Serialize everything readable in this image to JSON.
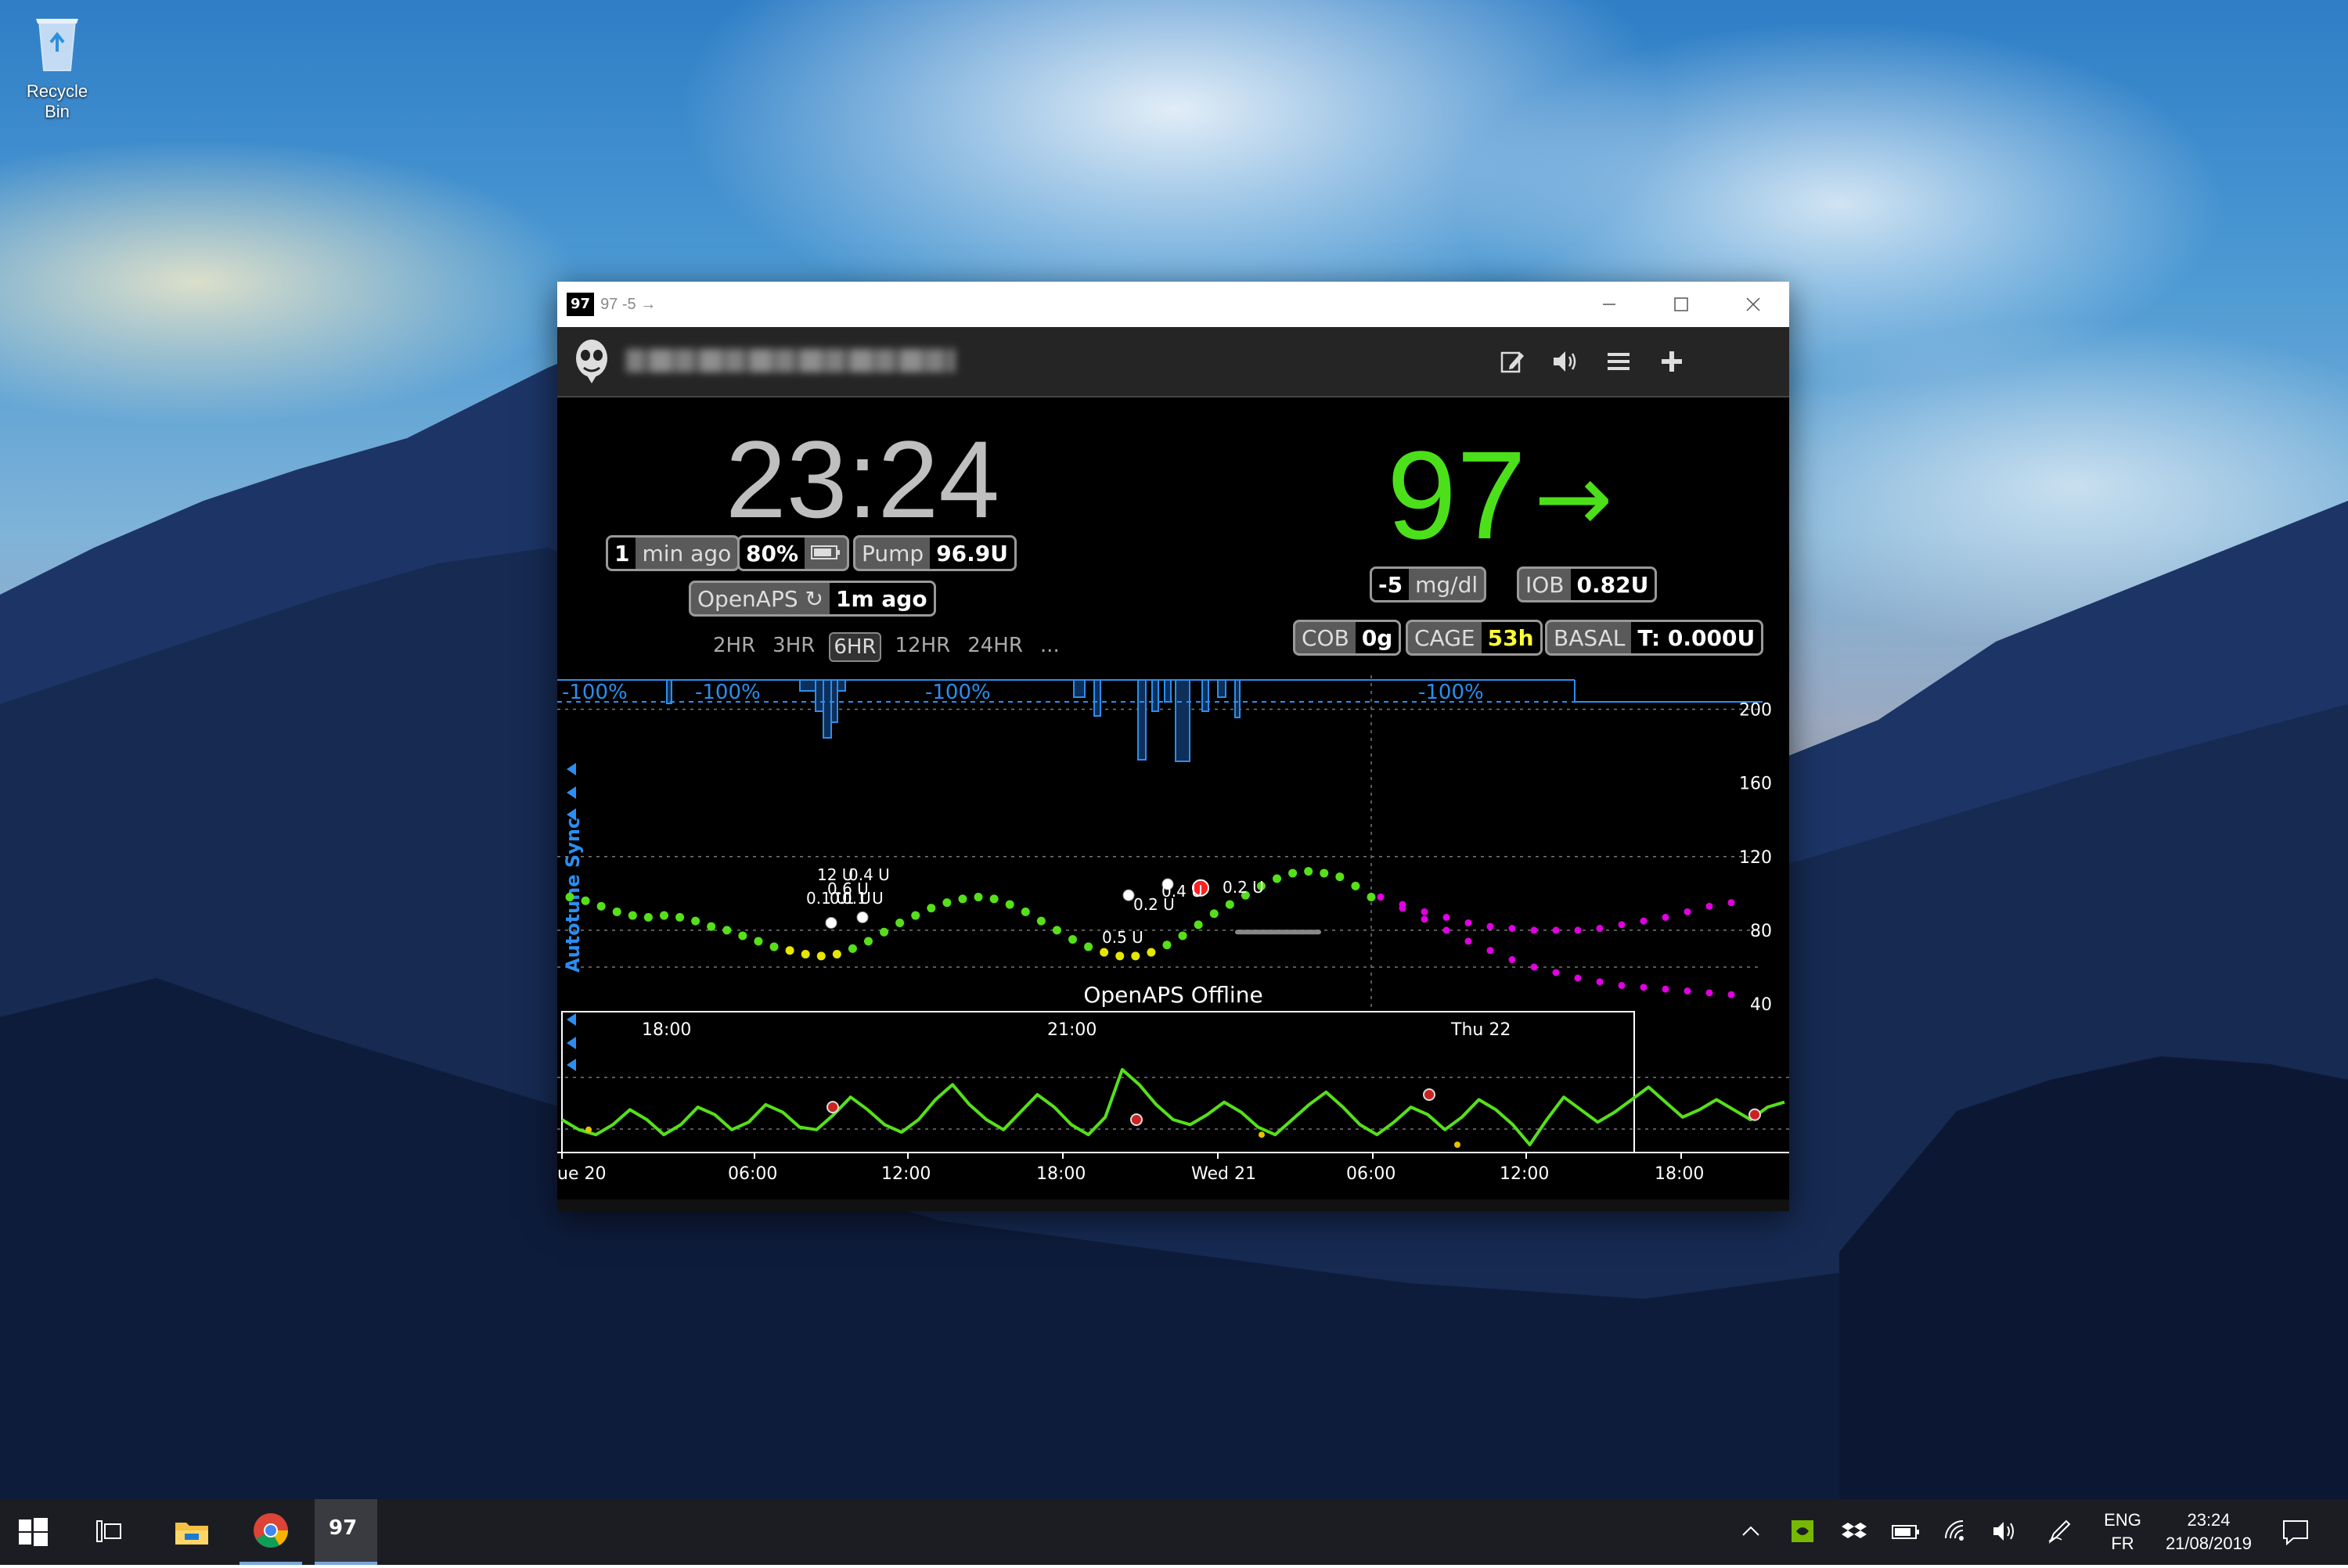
{
  "desktop": {
    "recycle_bin_label": "Recycle Bin"
  },
  "window": {
    "badge": "97",
    "title": "97 -5 →",
    "minimize_icon": "minimize-icon",
    "maximize_icon": "maximize-icon",
    "close_icon": "close-icon"
  },
  "appbar": {
    "icons": [
      "edit-icon",
      "speaker-icon",
      "menu-icon",
      "plus-icon"
    ]
  },
  "status": {
    "clock": "23:24",
    "last_reading_value": "1",
    "last_reading_label": "min ago",
    "battery_value": "80%",
    "pump_label": "Pump",
    "pump_value": "96.9U",
    "openaps_label": "OpenAPS ↻",
    "openaps_value": "1m ago",
    "bg": "97",
    "trend_arrow": "→",
    "delta_value": "-5",
    "delta_label": "mg/dl",
    "iob_label": "IOB",
    "iob_value": "0.82U",
    "cob_label": "COB",
    "cob_value": "0g",
    "cage_label": "CAGE",
    "cage_value": "53h",
    "basal_label": "BASAL",
    "basal_value": "T: 0.000U"
  },
  "ranges": [
    "2HR",
    "3HR",
    "6HR",
    "12HR",
    "24HR",
    "..."
  ],
  "selected_range": "6HR",
  "chart_data": [
    {
      "type": "scatter",
      "ylim": [
        40,
        210
      ],
      "y_ticks": [
        "200",
        "160",
        "120",
        "80",
        "40"
      ],
      "x_labels": [],
      "basal_labels": [
        "-100%",
        "-100%",
        "-100%",
        "-100%"
      ],
      "sidebar_label": "Autotune Sync",
      "offline_label": "OpenAPS Offline",
      "treatment_labels": [
        "12 U",
        "0.4 U",
        "0.6 U",
        "0.1 U",
        "0.1 U",
        "0.1 U",
        "0.5 U",
        "0.2 U",
        "0.4 U",
        "0.2 U"
      ],
      "bg_readings": [
        98,
        96,
        93,
        90,
        88,
        87,
        88,
        87,
        85,
        82,
        80,
        77,
        74,
        71,
        69,
        67,
        66,
        67,
        70,
        74,
        79,
        84,
        88,
        92,
        95,
        97,
        98,
        97,
        94,
        90,
        85,
        80,
        75,
        71,
        68,
        66,
        66,
        68,
        72,
        77,
        83,
        89,
        94,
        99,
        104,
        108,
        111,
        112,
        111,
        109,
        104,
        98
      ],
      "predicted_high": [
        98,
        94,
        90,
        87,
        84,
        82,
        81,
        80,
        80,
        80,
        81,
        83,
        85,
        87,
        90,
        93,
        95
      ],
      "predicted_low": [
        98,
        92,
        86,
        80,
        74,
        69,
        64,
        60,
        57,
        54,
        52,
        50,
        49,
        48,
        47,
        46,
        45
      ]
    },
    {
      "type": "line",
      "name": "",
      "x_labels": [
        "18:00",
        "21:00",
        "Thu 22"
      ],
      "bottom_labels": [
        "ue 20",
        "06:00",
        "12:00",
        "18:00",
        "Wed 21",
        "06:00",
        "12:00",
        "18:00"
      ],
      "values": [
        90,
        86,
        84,
        88,
        94,
        90,
        84,
        88,
        95,
        92,
        86,
        89,
        96,
        93,
        87,
        86,
        92,
        99,
        94,
        88,
        85,
        90,
        98,
        104,
        96,
        90,
        86,
        93,
        100,
        95,
        88,
        84,
        91,
        110,
        104,
        96,
        90,
        88,
        92,
        97,
        93,
        87,
        84,
        90,
        96,
        101,
        95,
        88,
        84,
        89,
        95,
        92,
        86,
        91,
        98,
        94,
        88,
        80,
        90,
        99,
        94,
        89,
        93,
        98,
        103,
        97,
        91,
        94,
        98,
        94,
        90,
        95,
        97
      ]
    }
  ],
  "taskbar": {
    "lang_top": "ENG",
    "lang_bottom": "FR",
    "time": "23:24",
    "date": "21/08/2019",
    "app_badge": "97"
  },
  "colors": {
    "bg_green": "#4ce01a",
    "prediction": "#e000e0",
    "basal_blue": "#1e90ff"
  }
}
